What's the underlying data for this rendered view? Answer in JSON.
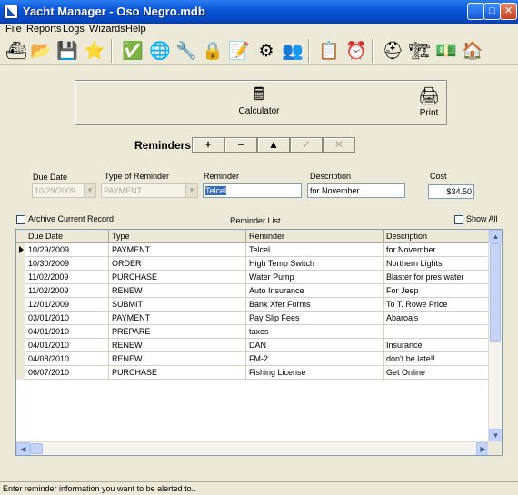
{
  "window": {
    "title": "Yacht Manager - Oso Negro.mdb"
  },
  "menu": [
    "File",
    "Reports",
    "Logs",
    "Wizards",
    "Help"
  ],
  "toolbar": {
    "buttons": [
      {
        "name": "boat-icon",
        "glyph": "⛴"
      },
      {
        "name": "folder-icon",
        "glyph": "📂"
      },
      {
        "name": "save-icon",
        "glyph": "💾"
      },
      {
        "name": "star-icon",
        "glyph": "⭐"
      },
      {
        "name": "checklist-icon",
        "glyph": "✅"
      },
      {
        "name": "globe-icon",
        "glyph": "🌐"
      },
      {
        "name": "tools-icon",
        "glyph": "🔧"
      },
      {
        "name": "lock-icon",
        "glyph": "🔒"
      },
      {
        "name": "notes-icon",
        "glyph": "📝"
      },
      {
        "name": "engine-icon",
        "glyph": "⚙"
      },
      {
        "name": "people-icon",
        "glyph": "👥"
      },
      {
        "name": "clipboard-icon",
        "glyph": "📋"
      },
      {
        "name": "clock-icon",
        "glyph": "⏰"
      },
      {
        "name": "lifebuoy-icon",
        "glyph": "⛑"
      },
      {
        "name": "dock-icon",
        "glyph": "🏗"
      },
      {
        "name": "money-icon",
        "glyph": "💵"
      },
      {
        "name": "house-icon",
        "glyph": "🏠"
      }
    ]
  },
  "panel": {
    "calculator": {
      "label": "Calculator",
      "icon": "calculator-icon",
      "glyph": "🖩"
    },
    "print": {
      "label": "Print",
      "icon": "printer-icon",
      "glyph": "🖨"
    }
  },
  "reminders": {
    "heading": "Reminders",
    "nav": [
      {
        "name": "add-button",
        "label": "+",
        "enabled": true
      },
      {
        "name": "delete-button",
        "label": "−",
        "enabled": true
      },
      {
        "name": "up-button",
        "label": "▲",
        "enabled": true
      },
      {
        "name": "confirm-button",
        "label": "✓",
        "enabled": false
      },
      {
        "name": "cancel-button",
        "label": "✕",
        "enabled": false
      }
    ]
  },
  "form": {
    "due_date_label": "Due Date",
    "due_date_value": "10/29/2009",
    "type_label": "Type of Reminder",
    "type_value": "PAYMENT",
    "reminder_label": "Reminder",
    "reminder_value": "Telcel",
    "description_label": "Description",
    "description_value": "for November",
    "cost_label": "Cost",
    "cost_value": "$34.50",
    "archive_label": "Archive Current Record",
    "list_title": "Reminder List",
    "show_all_label": "Show All"
  },
  "table": {
    "columns": [
      "Due Date",
      "Type",
      "Reminder",
      "Description"
    ],
    "rows": [
      [
        "10/29/2009",
        "PAYMENT",
        "Telcel",
        "for November"
      ],
      [
        "10/30/2009",
        "ORDER",
        "High Temp Switch",
        "Northern Lights"
      ],
      [
        "11/02/2009",
        "PURCHASE",
        "Water Pump",
        "Blaster for pres water"
      ],
      [
        "11/02/2009",
        "RENEW",
        "Auto Insurance",
        "For Jeep"
      ],
      [
        "12/01/2009",
        "SUBMIT",
        "Bank Xfer Forms",
        "To T. Rowe Price"
      ],
      [
        "03/01/2010",
        "PAYMENT",
        "Pay Slip Fees",
        "Abaroa's"
      ],
      [
        "04/01/2010",
        "PREPARE",
        "taxes",
        ""
      ],
      [
        "04/01/2010",
        "RENEW",
        "DAN",
        "Insurance"
      ],
      [
        "04/08/2010",
        "RENEW",
        "FM-2",
        "don't be late!!"
      ],
      [
        "06/07/2010",
        "PURCHASE",
        "Fishing License",
        "Get Online"
      ]
    ]
  },
  "status": {
    "text": "Enter reminder information you want to be alerted to.."
  }
}
